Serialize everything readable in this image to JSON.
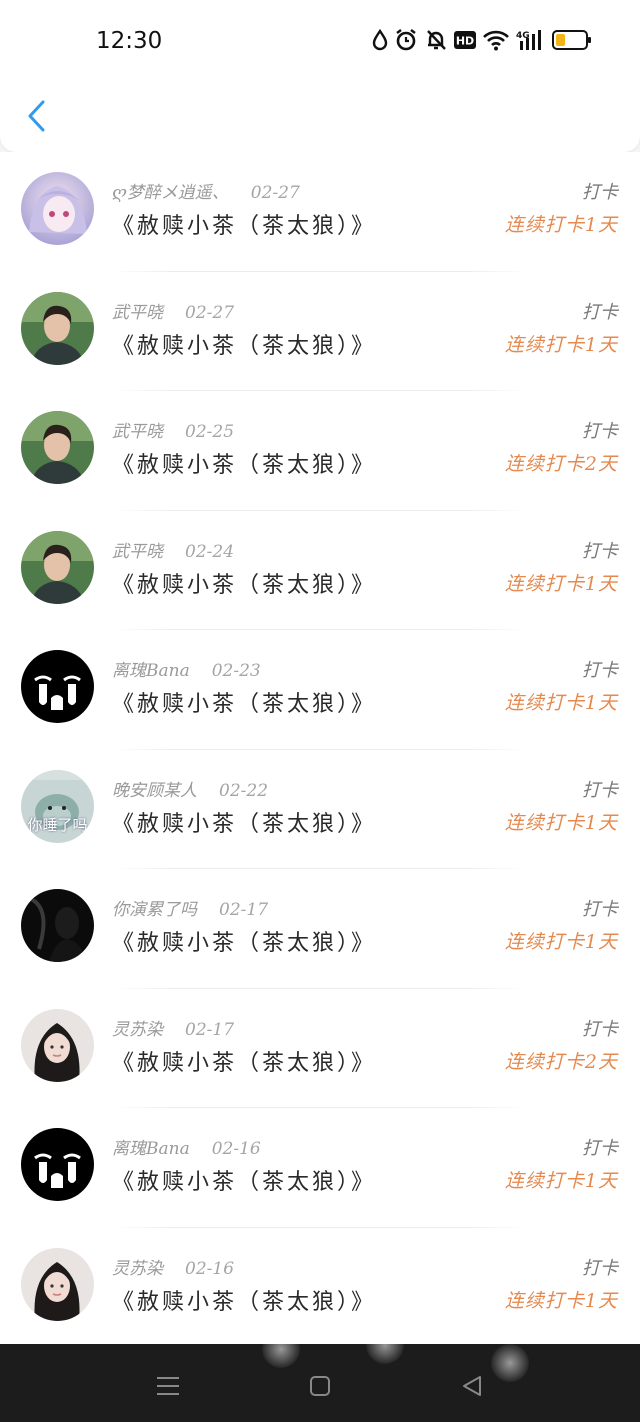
{
  "status_bar": {
    "time": "12:30",
    "icons": [
      "drop-icon",
      "alarm-icon",
      "mute-icon",
      "hd-icon",
      "wifi-icon",
      "signal-4g-icon",
      "battery-icon"
    ],
    "hd_label": "HD",
    "net_label": "4G"
  },
  "header": {
    "back_icon": "chevron-left-icon",
    "accent_color": "#2f9bef"
  },
  "records": [
    {
      "user": "ღ梦醉メ逍遥、",
      "date": "02-27",
      "title": "《赦赎小茶（茶太狼）》",
      "kind": "打卡",
      "streak": "连续打卡1天",
      "avatar": "anime-girl"
    },
    {
      "user": "武平晓",
      "date": "02-27",
      "title": "《赦赎小茶（茶太狼）》",
      "kind": "打卡",
      "streak": "连续打卡1天",
      "avatar": "young-man"
    },
    {
      "user": "武平晓",
      "date": "02-25",
      "title": "《赦赎小茶（茶太狼）》",
      "kind": "打卡",
      "streak": "连续打卡2天",
      "avatar": "young-man"
    },
    {
      "user": "武平晓",
      "date": "02-24",
      "title": "《赦赎小茶（茶太狼）》",
      "kind": "打卡",
      "streak": "连续打卡1天",
      "avatar": "young-man"
    },
    {
      "user": "离瑰Bana",
      "date": "02-23",
      "title": "《赦赎小茶（茶太狼）》",
      "kind": "打卡",
      "streak": "连续打卡1天",
      "avatar": "crying-face"
    },
    {
      "user": "晚安顾某人",
      "date": "02-22",
      "title": "《赦赎小茶（茶太狼）》",
      "kind": "打卡",
      "streak": "连续打卡1天",
      "avatar": "seal-cartoon",
      "avatar_text": "你睡了吗"
    },
    {
      "user": "你演累了吗",
      "date": "02-17",
      "title": "《赦赎小茶（茶太狼）》",
      "kind": "打卡",
      "streak": "连续打卡1天",
      "avatar": "dark-portrait"
    },
    {
      "user": "灵苏染",
      "date": "02-17",
      "title": "《赦赎小茶（茶太狼）》",
      "kind": "打卡",
      "streak": "连续打卡2天",
      "avatar": "girl-portrait"
    },
    {
      "user": "离瑰Bana",
      "date": "02-16",
      "title": "《赦赎小茶（茶太狼）》",
      "kind": "打卡",
      "streak": "连续打卡1天",
      "avatar": "crying-face"
    },
    {
      "user": "灵苏染",
      "date": "02-16",
      "title": "《赦赎小茶（茶太狼）》",
      "kind": "打卡",
      "streak": "连续打卡1天",
      "avatar": "girl-portrait"
    }
  ],
  "colors": {
    "streak": "#e58a4f",
    "meta": "#9a9a9a",
    "navbar": "#1c1c1c"
  },
  "navbar": {
    "buttons": [
      "menu-icon",
      "home-square-icon",
      "back-triangle-icon"
    ]
  }
}
